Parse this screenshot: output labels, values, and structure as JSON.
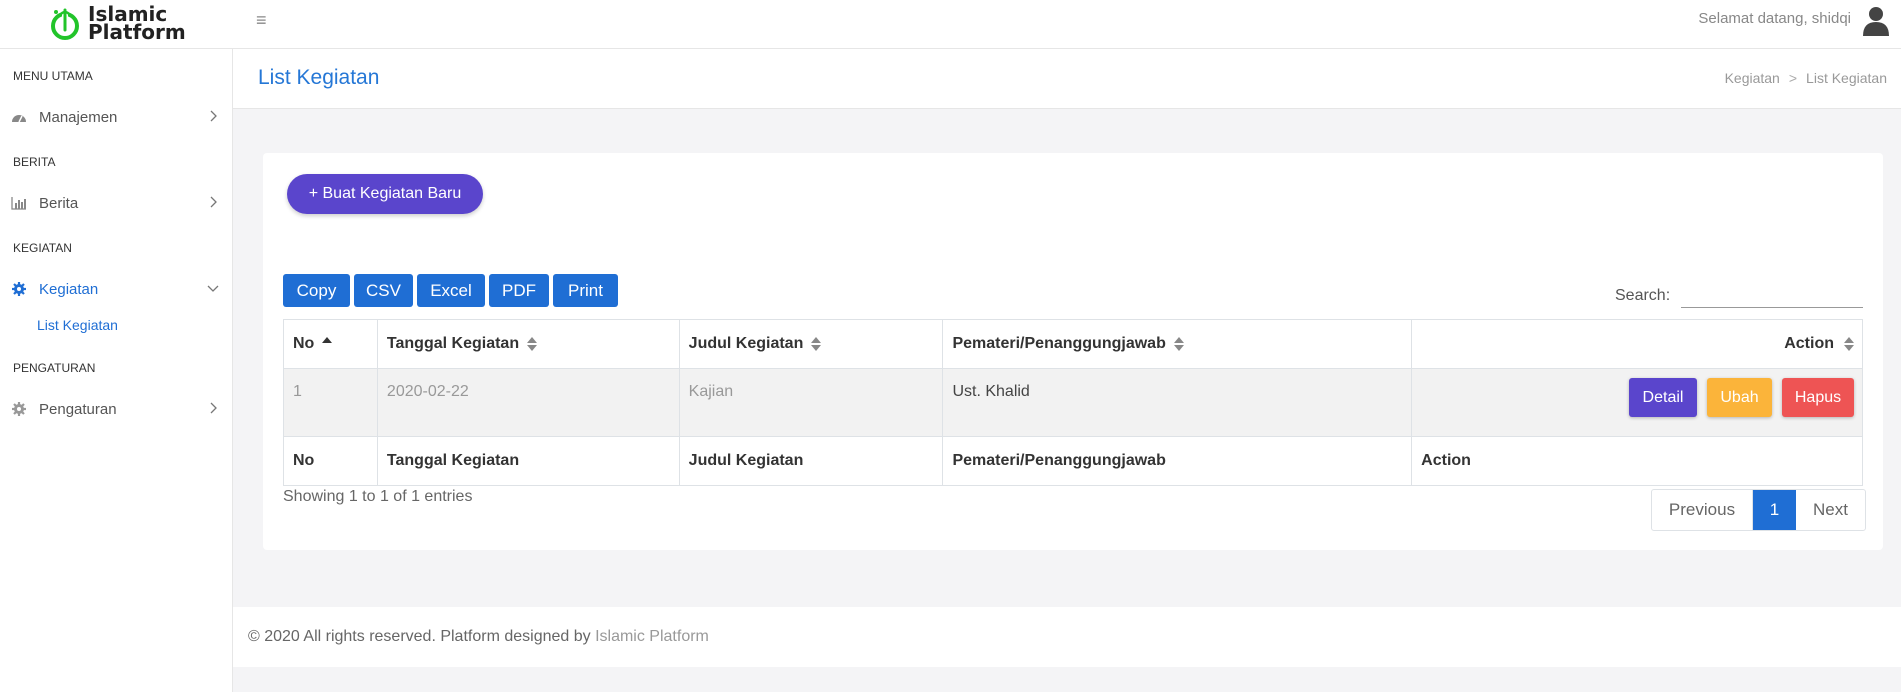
{
  "brand": {
    "line1": "Islamic",
    "line2": "Platform",
    "logo_color": "#22c42a"
  },
  "topbar": {
    "welcome": "Selamat datang, shidqi"
  },
  "sidebar": {
    "sections": [
      {
        "header": "MENU UTAMA",
        "item": "Manajemen",
        "icon": "dashboard-icon"
      },
      {
        "header": "BERITA",
        "item": "Berita",
        "icon": "bar-chart-icon"
      },
      {
        "header": "KEGIATAN",
        "item": "Kegiatan",
        "icon": "gear-icon",
        "sub": "List Kegiatan"
      },
      {
        "header": "PENGATURAN",
        "item": "Pengaturan",
        "icon": "gear-icon"
      }
    ]
  },
  "page": {
    "title": "List Kegiatan",
    "breadcrumb": [
      "Kegiatan",
      "List Kegiatan"
    ]
  },
  "card": {
    "new_button": "+ Buat Kegiatan Baru",
    "export_buttons": [
      "Copy",
      "CSV",
      "Excel",
      "PDF",
      "Print"
    ],
    "search_label": "Search:",
    "search_value": ""
  },
  "table": {
    "columns": [
      "No",
      "Tanggal Kegiatan",
      "Judul Kegiatan",
      "Pemateri/Penanggungjawab",
      "Action"
    ],
    "rows": [
      {
        "no": "1",
        "tanggal": "2020-02-22",
        "judul": "Kajian",
        "pemateri": "Ust. Khalid"
      }
    ],
    "row_actions": [
      "Detail",
      "Ubah",
      "Hapus"
    ],
    "info": "Showing 1 to 1 of 1 entries"
  },
  "pagination": {
    "previous": "Previous",
    "current": "1",
    "next": "Next"
  },
  "footer": {
    "text": "© 2020 All rights reserved. Platform designed by ",
    "link": "Islamic Platform"
  },
  "colors": {
    "primary": "#1f6ed4",
    "new_button": "#5a45cc",
    "detail": "#5a45cc",
    "ubah": "#fbb43a",
    "hapus": "#ee5454"
  }
}
